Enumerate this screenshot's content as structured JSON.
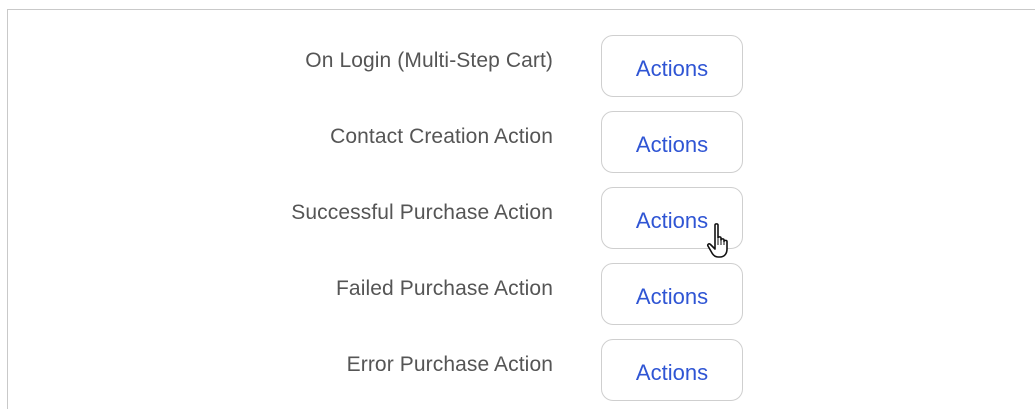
{
  "action_rows": [
    {
      "label": "On Login (Multi-Step Cart)",
      "button_label": "Actions"
    },
    {
      "label": "Contact Creation Action",
      "button_label": "Actions"
    },
    {
      "label": "Successful Purchase Action",
      "button_label": "Actions"
    },
    {
      "label": "Failed Purchase Action",
      "button_label": "Actions"
    },
    {
      "label": "Error Purchase Action",
      "button_label": "Actions"
    }
  ],
  "colors": {
    "button_text": "#2f55d4",
    "label_text": "#555555",
    "button_border": "#cfcfcf"
  },
  "icons": {
    "cursor": "hand-pointer-cursor-icon"
  }
}
